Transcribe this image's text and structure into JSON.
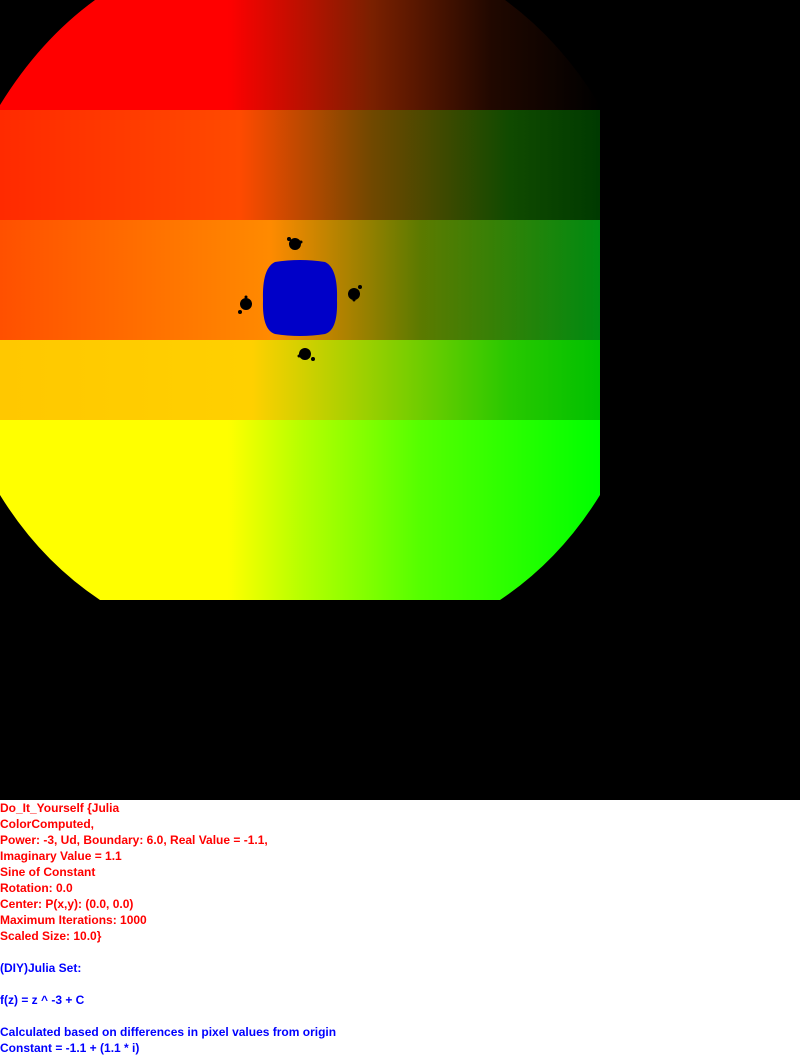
{
  "image": {
    "colors": {
      "background": "#000000",
      "corner_top_left": "#ff0000",
      "corner_top_right": "#000000",
      "corner_bottom_left": "#ffff00",
      "corner_bottom_right": "#00ff00",
      "interior_fill": "#0000c8",
      "satellite_fill": "#000000"
    }
  },
  "info": {
    "params": [
      "Do_It_Yourself {Julia",
      "ColorComputed,",
      "Power: -3, Ud, Boundary: 6.0, Real Value = -1.1,",
      "Imaginary Value = 1.1",
      "Sine of Constant",
      "Rotation: 0.0",
      "Center: P(x,y): (0.0, 0.0)",
      "Maximum Iterations: 1000",
      "Scaled Size: 10.0}"
    ],
    "set_name": "(DIY)Julia Set:",
    "formula": "f(z) = z ^ -3 + C",
    "calc_note": "Calculated based on differences in pixel values from origin",
    "constant": "Constant = -1.1 + (1.1 * i)"
  }
}
